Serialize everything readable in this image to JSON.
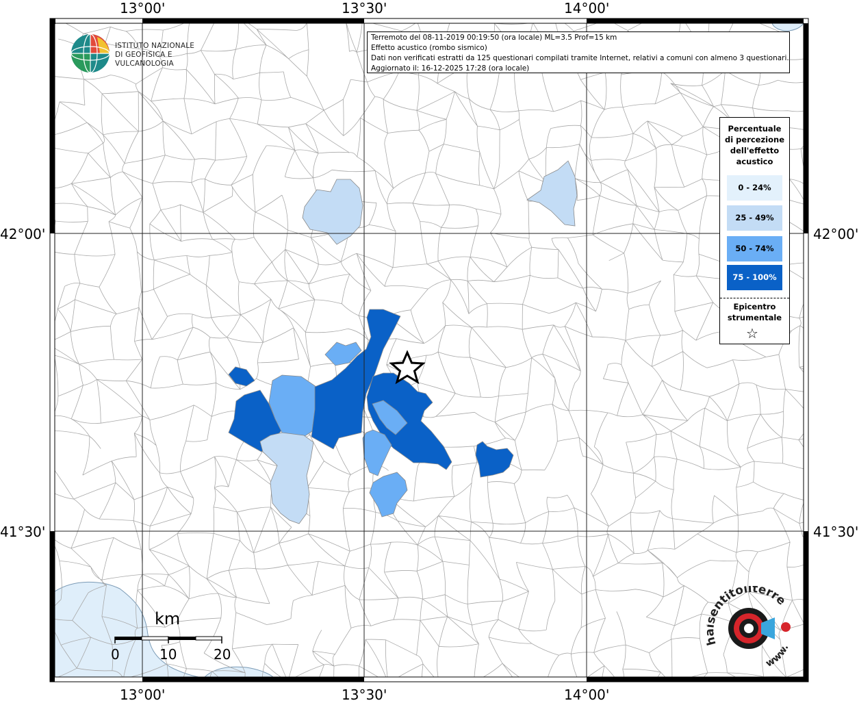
{
  "info": {
    "line1": "Terremoto del 08-11-2019 00:19:50 (ora locale) ML=3.5 Prof=15 km",
    "line2": "Effetto acustico (rombo sismico)",
    "line3": "Dati non verificati estratti da 125 questionari compilati tramite Internet, relativi a comuni con almeno 3 questionari.",
    "line4": "Aggiornato il: 16-12-2025 17:28 (ora locale)"
  },
  "logo": {
    "line1": "ISTITUTO NAZIONALE",
    "line2": "DI GEOFISICA E VULCANOLOGIA"
  },
  "legend": {
    "title1": "Percentuale",
    "title2": "di percezione",
    "title3": "dell'effetto",
    "title4": "acustico",
    "items": [
      {
        "label": "0 - 24%",
        "color": "#e3f1fc",
        "text_color": "#000000"
      },
      {
        "label": "25 - 49%",
        "color": "#c3dcf5",
        "text_color": "#000000"
      },
      {
        "label": "50 - 74%",
        "color": "#6aaef5",
        "text_color": "#000000"
      },
      {
        "label": "75 - 100%",
        "color": "#0a61c7",
        "text_color": "#ffffff"
      }
    ],
    "epi1": "Epicentro",
    "epi2": "strumentale",
    "star": "☆"
  },
  "axes": {
    "lon": [
      "13°00'",
      "13°30'",
      "14°00'"
    ],
    "lat": [
      "42°00'",
      "41°30'"
    ]
  },
  "scale": {
    "unit": "km",
    "ticks": [
      "0",
      "10",
      "20"
    ]
  },
  "badge": {
    "text_top": "haisentitoilterremoto.it",
    "text_bottom": "www."
  },
  "colors": {
    "sea": "#dfeefa",
    "boundary": "#9a9a9a",
    "class1": "#c3dcf5",
    "class2": "#6aaef5",
    "class3": "#0a61c7"
  }
}
